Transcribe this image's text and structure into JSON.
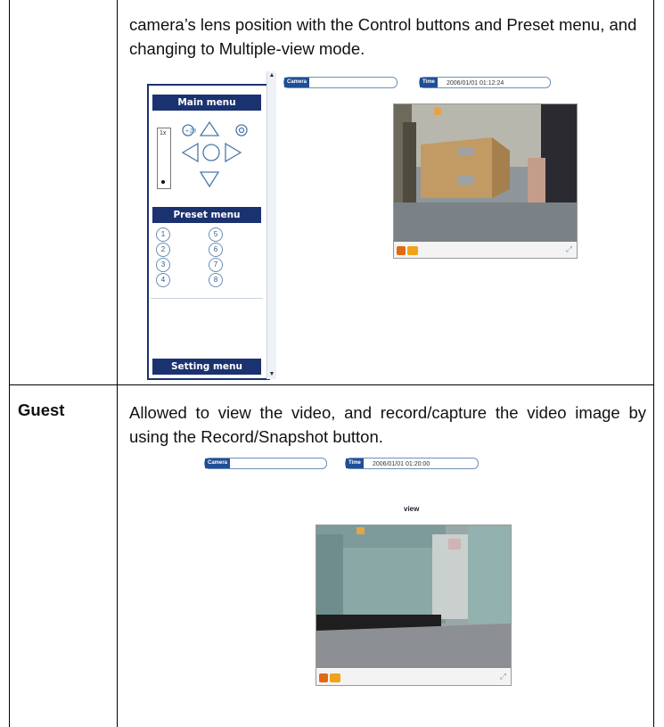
{
  "rows": [
    {
      "role": "",
      "description": "camera’s lens position with the Control buttons and Preset menu, and changing to Multiple-view mode."
    },
    {
      "role": "Guest",
      "description": "Allowed to view the video, and record/capture the video image by using the Record/Snapshot button."
    }
  ],
  "screenshot_admin": {
    "main_menu": "Main menu",
    "preset_menu": "Preset menu",
    "setting_menu": "Setting menu",
    "zoom": "1x",
    "presets": [
      "1",
      "2",
      "3",
      "4",
      "5",
      "6",
      "7",
      "8"
    ],
    "camera_tag": "Camera",
    "camera_value": "",
    "time_tag": "Time",
    "time_value": "2006/01/01 01:12:24"
  },
  "screenshot_guest": {
    "camera_tag": "Camera",
    "camera_value": "",
    "time_tag": "Time",
    "time_value": "2006/01/01 01:20:00",
    "view_label": "view"
  }
}
